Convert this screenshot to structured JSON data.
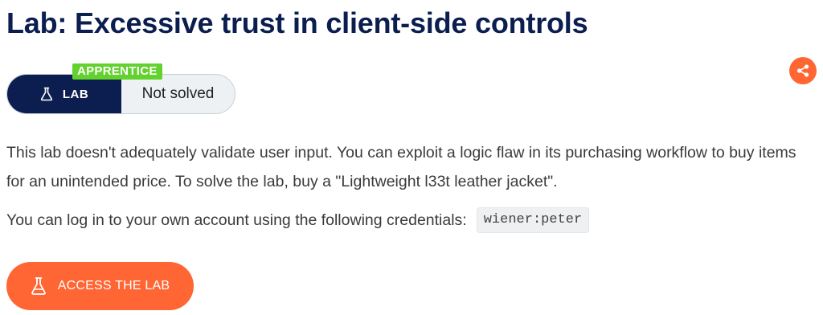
{
  "page": {
    "title": "Lab: Excessive trust in client-side controls"
  },
  "badge": {
    "level": "APPRENTICE",
    "lab_label": "LAB",
    "status": "Not solved"
  },
  "description": {
    "paragraph": "This lab doesn't adequately validate user input. You can exploit a logic flaw in its purchasing workflow to buy items for an unintended price. To solve the lab, buy a \"Lightweight l33t leather jacket\".",
    "credentials_text": "You can log in to your own account using the following credentials:",
    "credentials_value": "wiener:peter"
  },
  "actions": {
    "access_label": "ACCESS THE LAB"
  },
  "colors": {
    "accent": "#ff6633",
    "navy": "#0b1e4f",
    "level_green": "#63d12e"
  },
  "icons": {
    "share": "share-icon",
    "flask": "flask-icon"
  }
}
